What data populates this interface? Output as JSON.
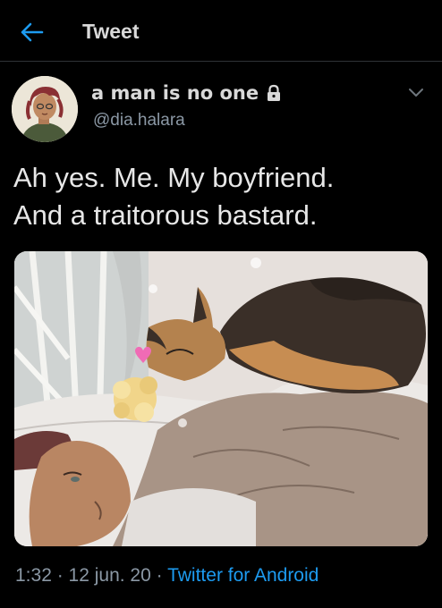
{
  "header": {
    "title": "Tweet",
    "back_icon": "arrow-left-icon",
    "accent": "#1d9bf0"
  },
  "author": {
    "display_name": "a man is no one",
    "handle": "@dia.halara",
    "protected_icon": "lock-icon"
  },
  "tweet": {
    "lines": [
      "Ah yes. Me. My boyfriend.",
      "And a traitorous bastard."
    ]
  },
  "media": {
    "icon": "heart-icon"
  },
  "meta": {
    "time": "1:32",
    "sep1": " · ",
    "date": "12 jun. 20",
    "sep2": " · ",
    "source": "Twitter for Android"
  },
  "colors": {
    "background": "#000000",
    "text": "#d9d9d9",
    "muted": "#8b98a5",
    "link": "#1d9bf0",
    "heart": "#f06bb5"
  }
}
